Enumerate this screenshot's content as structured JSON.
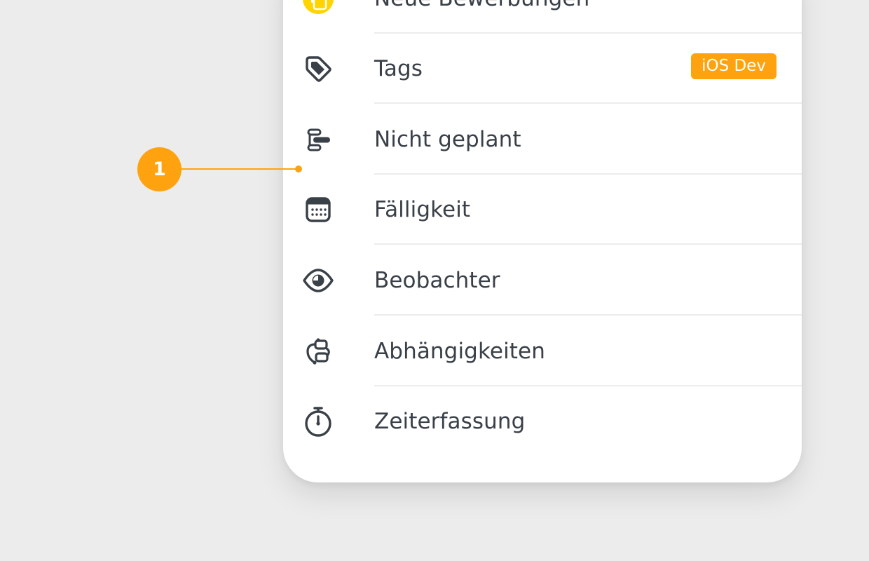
{
  "menu": {
    "items": [
      {
        "label": "Neue Bewerbungen",
        "icon": "stacked-documents-icon"
      },
      {
        "label": "Tags",
        "icon": "tag-icon",
        "badge": "iOS Dev"
      },
      {
        "label": "Nicht geplant",
        "icon": "unscheduled-bars-icon"
      },
      {
        "label": "Fälligkeit",
        "icon": "calendar-icon"
      },
      {
        "label": "Beobachter",
        "icon": "eye-icon"
      },
      {
        "label": "Abhängigkeiten",
        "icon": "dependencies-icon"
      },
      {
        "label": "Zeiterfassung",
        "icon": "stopwatch-icon"
      }
    ]
  },
  "callout": {
    "number": "1"
  },
  "colors": {
    "accent": "#ffa20f",
    "icon_yellow": "#ffd400",
    "text": "#3a4048",
    "background": "#ececec"
  }
}
